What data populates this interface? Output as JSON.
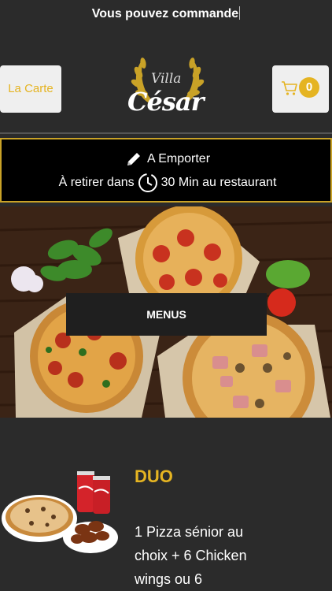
{
  "ticker": {
    "text": "Vous pouvez commande"
  },
  "header": {
    "carte_label": "La Carte",
    "cart_count": "0",
    "logo_top": "Villa",
    "logo_main": "César"
  },
  "order_mode": {
    "mode": "A Emporter",
    "pickup_prefix": "À retirer dans",
    "pickup_time": "30 Min au restaurant"
  },
  "hero": {
    "button_label": "MENUS"
  },
  "product": {
    "title": "DUO",
    "description": "1 Pizza sénior au choix + 6 Chicken wings ou 6"
  },
  "colors": {
    "background": "#2b2b2b",
    "accent": "#e5b422",
    "button_bg": "#efefef"
  }
}
